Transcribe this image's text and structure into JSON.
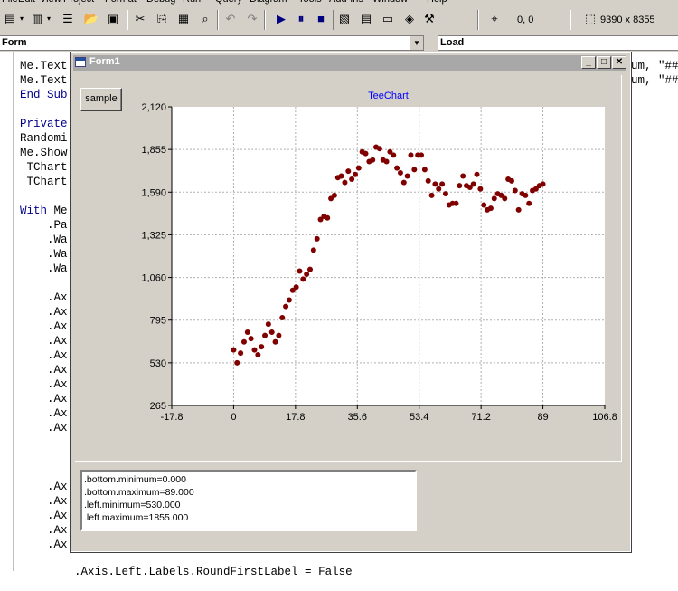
{
  "ide": {
    "menu": [
      "File",
      "Edit",
      "View",
      "Project",
      "Format",
      "Debug",
      "Run",
      "Query",
      "Diagram",
      "Tools",
      "Add-Ins",
      "Window",
      "Help"
    ],
    "toolbar": {
      "position": "0, 0",
      "size": "9390 x 8355"
    },
    "object_combo": "Form",
    "proc_combo": "Load"
  },
  "code": {
    "lines_top": [
      {
        "text": "Me.Text",
        "tail": "um, \"##"
      },
      {
        "text": "Me.Text",
        "tail": "um, \"##"
      },
      {
        "text": "End Sub",
        "tail": ""
      },
      {
        "text": "",
        "tail": ""
      },
      {
        "text": "Private",
        "tail": ""
      },
      {
        "text": "Randomi",
        "tail": ""
      },
      {
        "text": "Me.Show",
        "tail": ""
      },
      {
        "text": " TChart",
        "tail": ""
      },
      {
        "text": " TChart",
        "tail": ""
      },
      {
        "text": "",
        "tail": ""
      },
      {
        "text": "With Me",
        "tail": ""
      },
      {
        "text": "    .Pa",
        "tail": ""
      },
      {
        "text": "    .Wa",
        "tail": ""
      },
      {
        "text": "    .Wa",
        "tail": ""
      },
      {
        "text": "    .Wa",
        "tail": ""
      },
      {
        "text": "",
        "tail": ""
      },
      {
        "text": "    .Ax",
        "tail": ""
      },
      {
        "text": "    .Ax",
        "tail": ""
      },
      {
        "text": "    .Ax",
        "tail": ""
      },
      {
        "text": "    .Ax",
        "tail": ""
      },
      {
        "text": "    .Ax",
        "tail": ""
      },
      {
        "text": "    .Ax",
        "tail": ""
      },
      {
        "text": "    .Ax",
        "tail": ""
      },
      {
        "text": "    .Ax",
        "tail": ""
      },
      {
        "text": "    .Ax",
        "tail": ""
      },
      {
        "text": "    .Ax",
        "tail": ""
      }
    ],
    "lines_bottom": [
      "    .Ax",
      "    .Ax",
      "    .Ax",
      "    .Ax",
      "    .Ax"
    ],
    "last_line": "    .Axis.Left.Labels.RoundFirstLabel = False"
  },
  "form": {
    "title": "Form1",
    "sample_button": "sample",
    "memo_lines": [
      ".bottom.minimum=0.000",
      ".bottom.maximum=89.000",
      ".left.minimum=530.000",
      ".left.maximum=1855.000"
    ]
  },
  "chart_data": {
    "type": "scatter",
    "title": "TeeChart",
    "xlabel": "",
    "ylabel": "",
    "xlim": [
      -17.8,
      106.8
    ],
    "ylim": [
      265,
      2120
    ],
    "x_ticks": [
      "-17.8",
      "0",
      "17.8",
      "35.6",
      "53.4",
      "71.2",
      "89",
      "106.8"
    ],
    "y_ticks": [
      "265",
      "530",
      "795",
      "1,060",
      "1,325",
      "1,590",
      "1,855",
      "2,120"
    ],
    "grid": true,
    "marker_color": "#800000",
    "x": [
      0,
      1,
      2,
      3,
      4,
      5,
      6,
      7,
      8,
      9,
      10,
      11,
      12,
      13,
      14,
      15,
      16,
      17,
      18,
      19,
      20,
      21,
      22,
      23,
      24,
      25,
      26,
      27,
      28,
      29,
      30,
      31,
      32,
      33,
      34,
      35,
      36,
      37,
      38,
      39,
      40,
      41,
      42,
      43,
      44,
      45,
      46,
      47,
      48,
      49,
      50,
      51,
      52,
      53,
      54,
      55,
      56,
      57,
      58,
      59,
      60,
      61,
      62,
      63,
      64,
      65,
      66,
      67,
      68,
      69,
      70,
      71,
      72,
      73,
      74,
      75,
      76,
      77,
      78,
      79,
      80,
      81,
      82,
      83,
      84,
      85,
      86,
      87,
      88,
      89
    ],
    "y": [
      610,
      530,
      590,
      660,
      720,
      680,
      610,
      580,
      630,
      700,
      770,
      720,
      660,
      700,
      810,
      880,
      920,
      980,
      1000,
      1100,
      1050,
      1080,
      1110,
      1230,
      1300,
      1420,
      1440,
      1430,
      1550,
      1570,
      1680,
      1690,
      1650,
      1720,
      1670,
      1700,
      1740,
      1840,
      1830,
      1780,
      1790,
      1870,
      1860,
      1790,
      1780,
      1840,
      1820,
      1740,
      1710,
      1650,
      1690,
      1820,
      1730,
      1820,
      1820,
      1730,
      1660,
      1570,
      1640,
      1610,
      1640,
      1580,
      1510,
      1520,
      1520,
      1630,
      1690,
      1630,
      1620,
      1640,
      1700,
      1610,
      1510,
      1480,
      1490,
      1550,
      1580,
      1570,
      1550,
      1670,
      1660,
      1600,
      1480,
      1580,
      1570,
      1520,
      1600,
      1610,
      1630,
      1640
    ]
  }
}
